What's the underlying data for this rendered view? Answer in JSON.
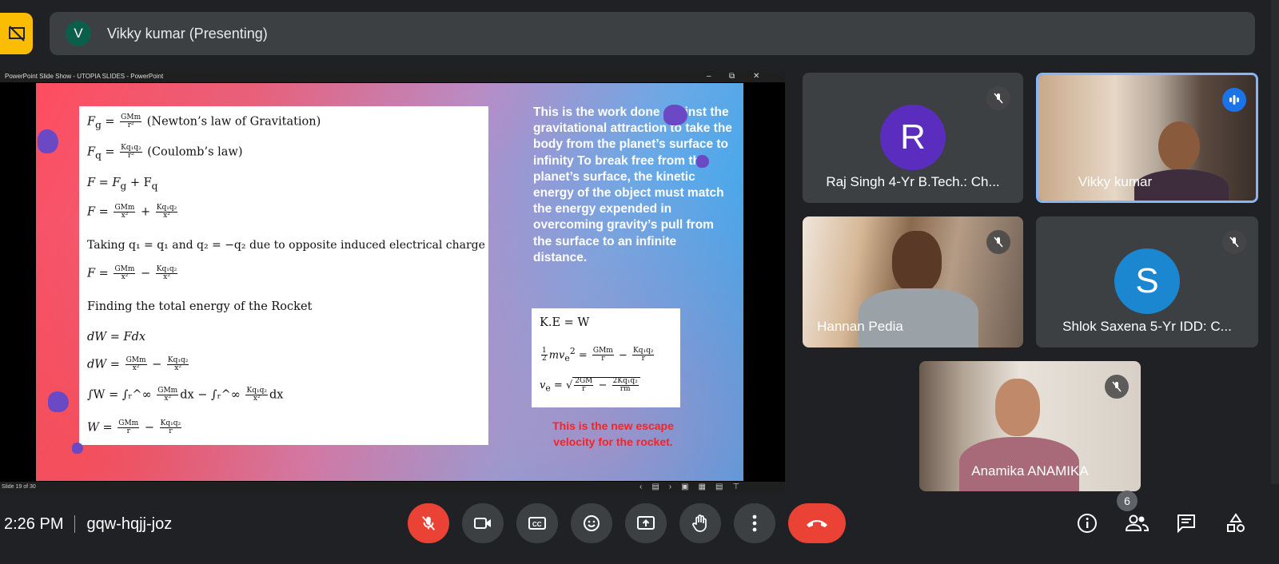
{
  "presenter": {
    "initial": "V",
    "label": "Vikky kumar (Presenting)",
    "avatar_color": "#0b5e4a"
  },
  "ppt": {
    "title": "PowerPoint Slide Show  -  UTOPIA SLIDES  -  PowerPoint",
    "status": "Slide 19 of 30",
    "controls": {
      "min": "–",
      "max": "⧉",
      "close": "✕"
    }
  },
  "slide": {
    "eq": {
      "e1_lhs": "F",
      "e1_sub": "g",
      "e1_num": "GMm",
      "e1_den": "r²",
      "e1_note": "(Newton’s law of Gravitation)",
      "e2_lhs": "F",
      "e2_sub": "q",
      "e2_num": "Kq₁q₂",
      "e2_den": "r²",
      "e2_note": "(Coulomb’s law)",
      "e3": "F = F",
      "e3_a": "g",
      "e3_b": " + F",
      "e3_c": "q",
      "e4_num1": "GMm",
      "e4_den": "x²",
      "e4_num2": "Kq₁q₂",
      "e5": "Taking q₁ = q₁ and q₂ = −q₂ due to opposite induced electrical charge",
      "e7": "Finding the total energy of the Rocket",
      "e8": "dW = Fdx",
      "e10_int": "∫W = ∫ᵣ^∞",
      "e10_mid": "dx − ∫ᵣ^∞",
      "e10_end": "dx",
      "e11_den": "r"
    },
    "text": "This is the work done against the gravitational attraction to take the body  from the planet’s surface to infinity To break free from the planet’s surface, the kinetic energy of the object must match the energy expended in overcoming gravity’s pull from the surface to an infinite distance.",
    "ke": {
      "l1": "K.E = W",
      "l2_lhs": "mv",
      "l2_sub": "e",
      "l2_sup": "2",
      "half_n": "1",
      "half_d": "2",
      "num1": "GMm",
      "num2": "Kq₁q₂",
      "den": "r",
      "l3_lhs": "v",
      "l3_sub": "e",
      "l3_n1": "2GM",
      "l3_d1": "r",
      "l3_n2": "2Kq₁q₂",
      "l3_d2": "rm"
    },
    "red_note": "This is the new escape velocity for the rocket."
  },
  "participants": [
    {
      "name": "Raj Singh 4-Yr B.Tech.: Ch...",
      "initial": "R",
      "color": "#5b2dbe",
      "muted": true
    },
    {
      "name": "Vikky kumar",
      "speaking": true
    },
    {
      "name": "Hannan Pedia",
      "muted": true
    },
    {
      "name": "Shlok Saxena 5-Yr IDD: C...",
      "initial": "S",
      "color": "#1a87d0",
      "muted": true
    },
    {
      "name": "Anamika ANAMIKA",
      "muted": true
    }
  ],
  "bottom": {
    "time": "2:26 PM",
    "code": "gqw-hqjj-joz",
    "people_count": "6"
  },
  "colors": {
    "bg": "#202124",
    "tile": "#3c4043",
    "danger": "#ea4335",
    "accent": "#1a73e8"
  }
}
